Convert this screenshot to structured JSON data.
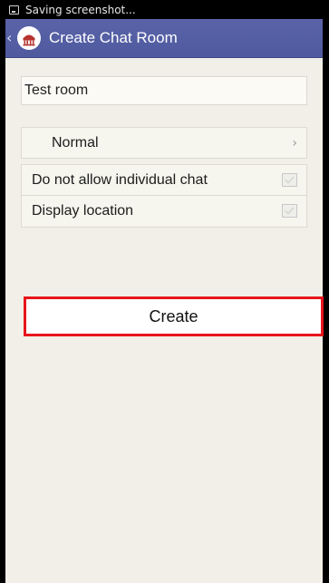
{
  "status_bar": {
    "text": "Saving screenshot...",
    "icon": "screenshot-icon"
  },
  "app_bar": {
    "title": "Create Chat Room",
    "back_icon": "chevron-left-icon",
    "logo_icon": "building-logo-icon"
  },
  "form": {
    "room_name_value": "Test room",
    "room_type": {
      "value": "Normal",
      "icon": "chevron-right-icon"
    },
    "options": [
      {
        "label": "Do not allow individual chat",
        "checked": false
      },
      {
        "label": "Display location",
        "checked": false
      }
    ],
    "create_label": "Create"
  },
  "colors": {
    "app_bar": "#525ca3",
    "background": "#f1efe7",
    "highlight_border": "#e8141c"
  }
}
